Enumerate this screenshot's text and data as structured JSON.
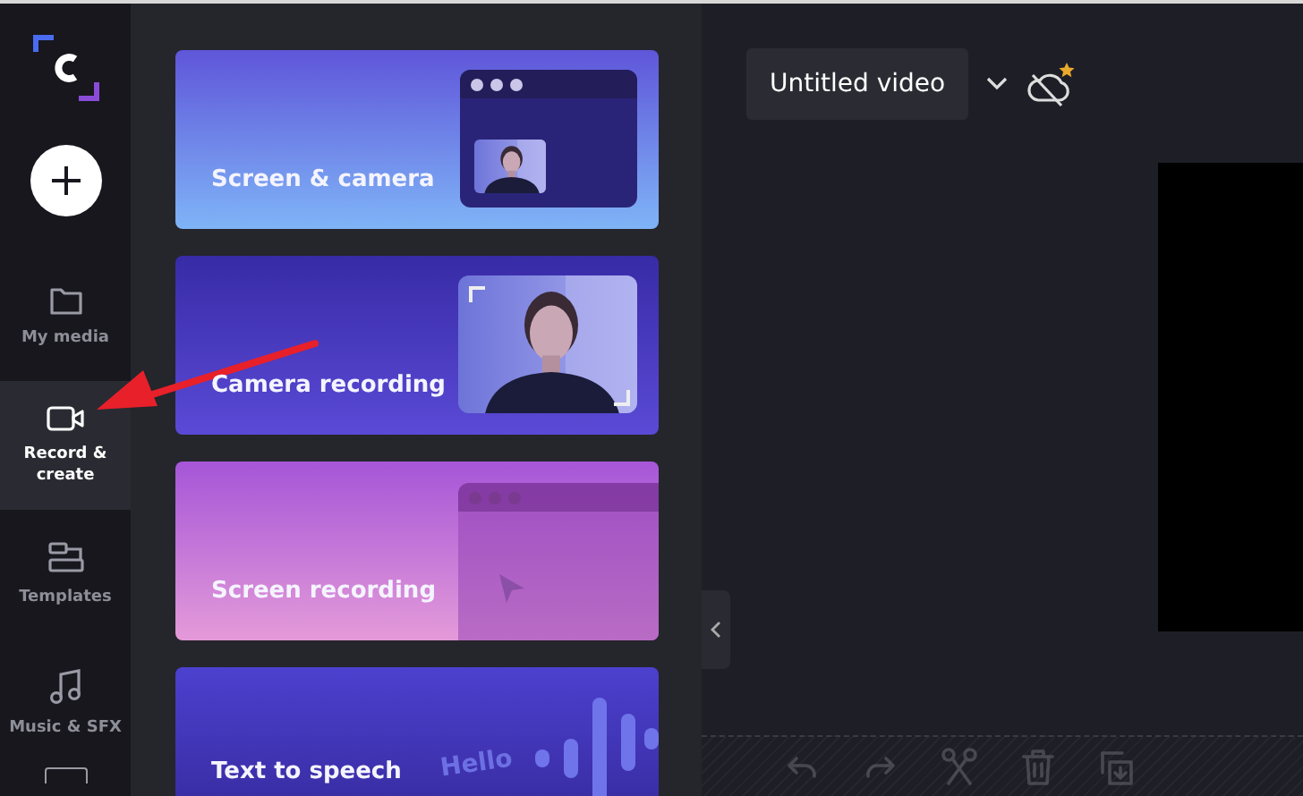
{
  "nav": {
    "items": [
      {
        "label": "My media",
        "selected": false
      },
      {
        "label": "Record & create",
        "selected": true
      },
      {
        "label": "Templates",
        "selected": false
      },
      {
        "label": "Music & SFX",
        "selected": false
      }
    ]
  },
  "cards": [
    {
      "label": "Screen & camera",
      "kind": "screen-camera"
    },
    {
      "label": "Camera recording",
      "kind": "camera"
    },
    {
      "label": "Screen recording",
      "kind": "screen"
    },
    {
      "label": "Text to speech",
      "kind": "speech",
      "bubble": "Hello"
    }
  ],
  "project": {
    "title": "Untitled video"
  },
  "toolbar": [
    {
      "disabled": true
    },
    {
      "disabled": true
    },
    {
      "disabled": true
    },
    {
      "disabled": true
    },
    {
      "disabled": true
    }
  ]
}
